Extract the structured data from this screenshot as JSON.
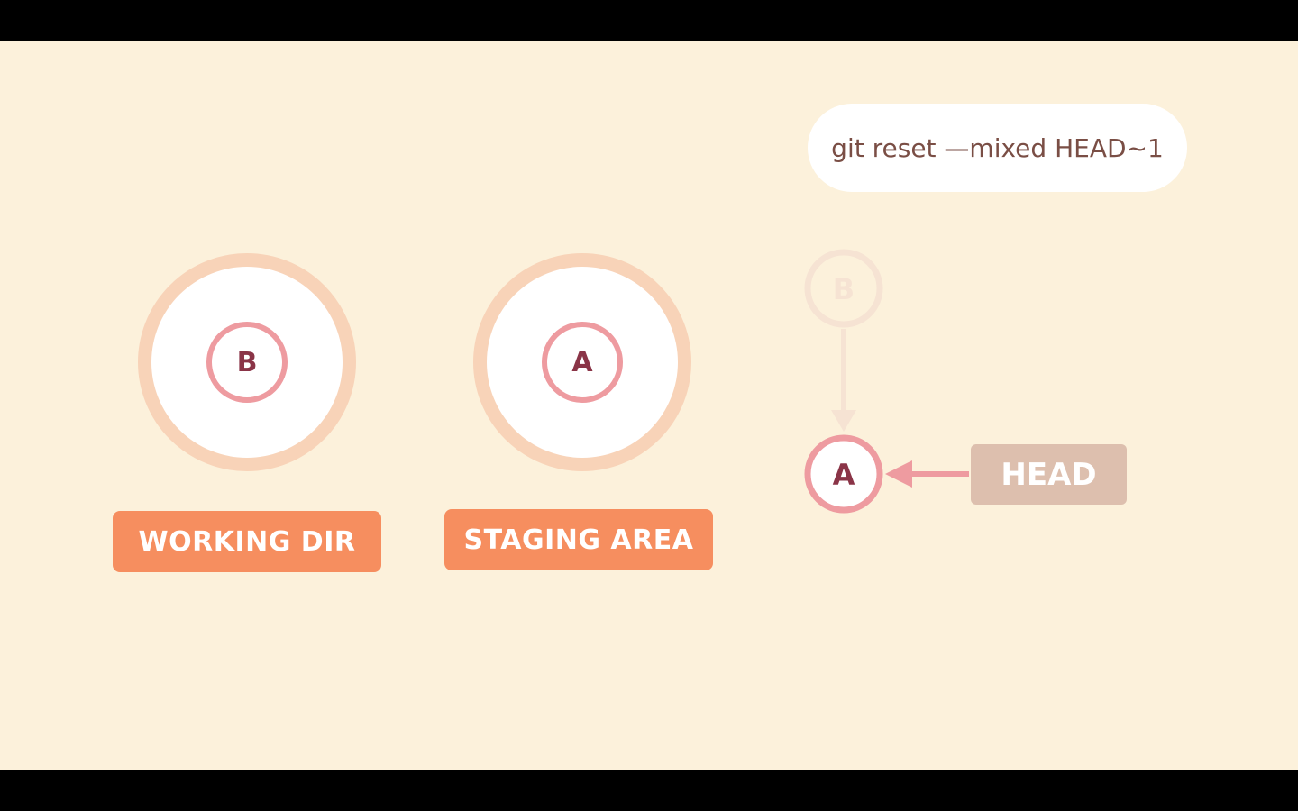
{
  "command": "git reset —mixed HEAD~1",
  "working_dir": {
    "label": "WORKING DIR",
    "commit": "B"
  },
  "staging_area": {
    "label": "STAGING AREA",
    "commit": "A"
  },
  "history": {
    "faded_commit": "B",
    "current_commit": "A",
    "head_label": "HEAD"
  },
  "colors": {
    "background": "#FCF1DB",
    "ring": "#F8D3B8",
    "commit_border": "#EE9BA0",
    "commit_text": "#8A3447",
    "label_orange": "#F68E5F",
    "head_label": "#DDBFAE",
    "faded": "#F6E3D3"
  }
}
